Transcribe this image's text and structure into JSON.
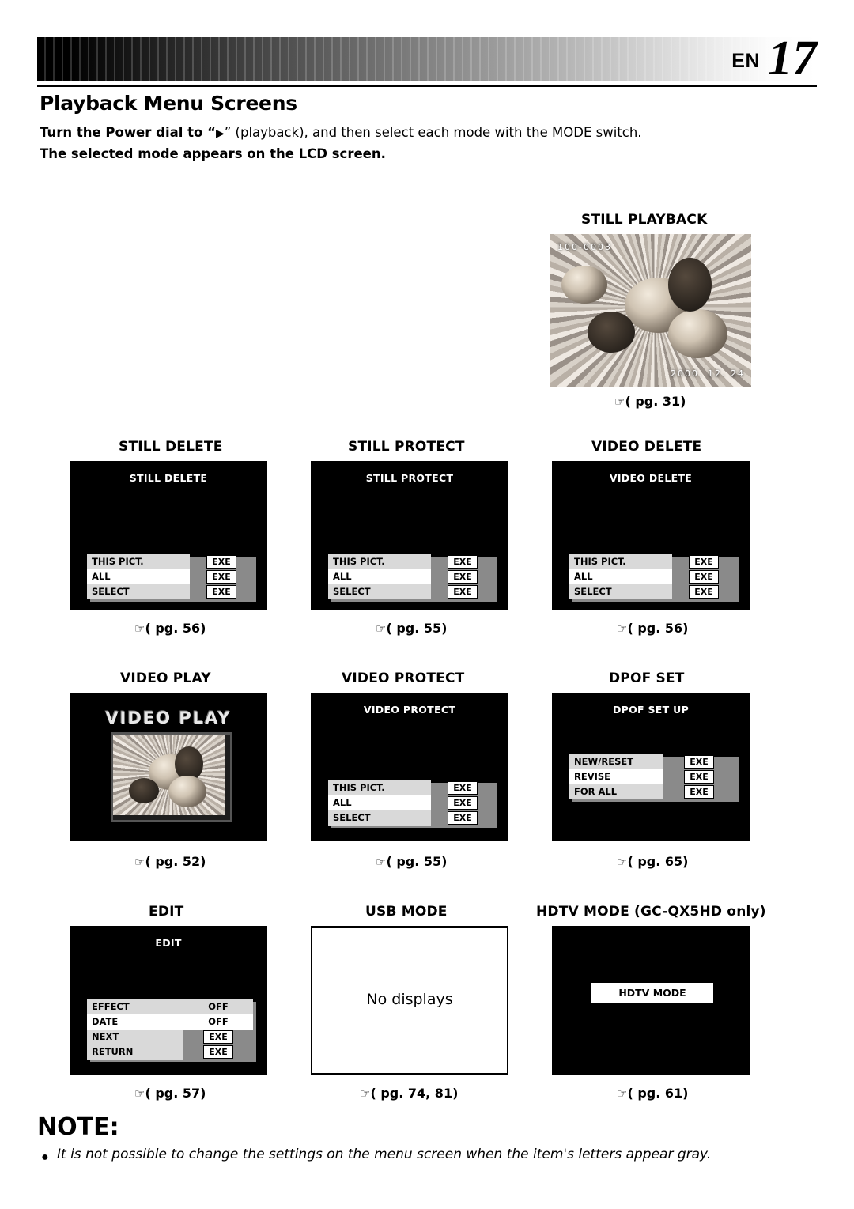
{
  "header": {
    "en_label": "EN",
    "page_number": "17"
  },
  "title": "Playback Menu Screens",
  "subtitle_line1_pre": "Turn the Power dial to “",
  "subtitle_glyph": "▶",
  "subtitle_line1_post": "” (playback), and then select each mode with the MODE switch.",
  "subtitle_line2": "The selected mode appears on the LCD screen.",
  "still_playback": {
    "caption": "STILL PLAYBACK",
    "file_number": "100-0003",
    "date_stamp": "2000. 12. 24",
    "pg": "( pg. 31)"
  },
  "panels": [
    {
      "caption": "STILL DELETE",
      "screen_title": "STILL DELETE",
      "pg": "( pg. 56)",
      "rows": [
        {
          "label": "THIS PICT.",
          "value": "EXE",
          "selected": false
        },
        {
          "label": "ALL",
          "value": "EXE",
          "selected": true
        },
        {
          "label": "SELECT",
          "value": "EXE",
          "selected": false
        }
      ]
    },
    {
      "caption": "STILL PROTECT",
      "screen_title": "STILL PROTECT",
      "pg": "( pg. 55)",
      "rows": [
        {
          "label": "THIS PICT.",
          "value": "EXE",
          "selected": false
        },
        {
          "label": "ALL",
          "value": "EXE",
          "selected": true
        },
        {
          "label": "SELECT",
          "value": "EXE",
          "selected": false
        }
      ]
    },
    {
      "caption": "VIDEO DELETE",
      "screen_title": "VIDEO DELETE",
      "pg": "( pg. 56)",
      "rows": [
        {
          "label": "THIS PICT.",
          "value": "EXE",
          "selected": false
        },
        {
          "label": "ALL",
          "value": "EXE",
          "selected": true
        },
        {
          "label": "SELECT",
          "value": "EXE",
          "selected": false
        }
      ]
    }
  ],
  "video_play": {
    "caption": "VIDEO PLAY",
    "screen_text": "VIDEO PLAY",
    "pg": "( pg. 52)"
  },
  "video_protect": {
    "caption": "VIDEO PROTECT",
    "screen_title": "VIDEO PROTECT",
    "pg": "( pg. 55)",
    "rows": [
      {
        "label": "THIS PICT.",
        "value": "EXE",
        "selected": false
      },
      {
        "label": "ALL",
        "value": "EXE",
        "selected": true
      },
      {
        "label": "SELECT",
        "value": "EXE",
        "selected": false
      }
    ]
  },
  "dpof_set": {
    "caption": "DPOF SET",
    "screen_title": "DPOF SET UP",
    "pg": "( pg. 65)",
    "rows": [
      {
        "label": "NEW/RESET",
        "value": "EXE",
        "selected": false
      },
      {
        "label": "REVISE",
        "value": "EXE",
        "selected": true
      },
      {
        "label": "FOR ALL",
        "value": "EXE",
        "selected": false
      }
    ]
  },
  "edit": {
    "caption": "EDIT",
    "screen_title": "EDIT",
    "pg": "( pg. 57)",
    "rows": [
      {
        "label": "EFFECT",
        "value": "OFF",
        "selected": false
      },
      {
        "label": "DATE",
        "value": "OFF",
        "selected": true
      },
      {
        "label": "NEXT",
        "value": "EXE",
        "selected": false
      },
      {
        "label": "RETURN",
        "value": "EXE",
        "selected": false
      }
    ]
  },
  "usb_mode": {
    "caption": "USB MODE",
    "screen_text": "No displays",
    "pg": "( pg. 74, 81)"
  },
  "hdtv_mode": {
    "caption": "HDTV MODE (GC-QX5HD only)",
    "button_label": "HDTV MODE",
    "pg": "( pg. 61)"
  },
  "note": {
    "title": "NOTE:",
    "bullet": "●",
    "body": "It is not possible to change the settings on the menu screen when the item's letters appear gray."
  }
}
